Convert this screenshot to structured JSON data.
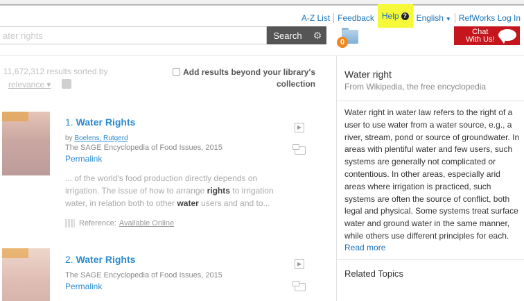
{
  "nav": {
    "az_list": "A-Z List",
    "feedback": "Feedback",
    "help": "Help",
    "help_badge": "?",
    "language": "English",
    "refworks": "RefWorks Log In"
  },
  "search": {
    "value": "ater rights",
    "button": "Search",
    "gear": "⚙"
  },
  "folder": {
    "count": "0"
  },
  "chat": {
    "line1": "Chat",
    "line2": "With Us!"
  },
  "results_meta": {
    "count_text": "11,672,312 results sorted by",
    "sort": "relevance",
    "add_results_line1": "Add results beyond your library's",
    "add_results_line2": "collection"
  },
  "results": [
    {
      "number": "1.",
      "title": "Water Rights",
      "author_prefix": "by",
      "author": "Boelens, Rutgerd",
      "source": "The SAGE Encyclopedia of Food Issues, 2015",
      "permalink": "Permalink",
      "snippet_a": "... of the world's food production directly depends on irrigation. The issue of how to arrange ",
      "snippet_b": "rights",
      "snippet_c": " to irrigation water, in relation both to other ",
      "snippet_d": "water",
      "snippet_e": " users and and to...",
      "ref_label": "Reference:",
      "ref_link": "Available Online"
    },
    {
      "number": "2.",
      "title": "Water Rights",
      "source": "The SAGE Encyclopedia of Food Issues, 2015",
      "permalink": "Permalink"
    }
  ],
  "wiki": {
    "title": "Water right",
    "subtitle": "From Wikipedia, the free encyclopedia",
    "body": "Water right in water law refers to the right of a user to use water from a water source, e.g., a river, stream, pond or source of groundwater. In areas with plentiful water and few users, such systems are generally not complicated or contentious. In other areas, especially arid areas where irrigation is practiced, such systems are often the source of conflict, both legal and physical. Some systems treat surface water and ground water in the same manner, while others use different principles for each.",
    "read_more": "Read more",
    "related": "Related Topics"
  }
}
